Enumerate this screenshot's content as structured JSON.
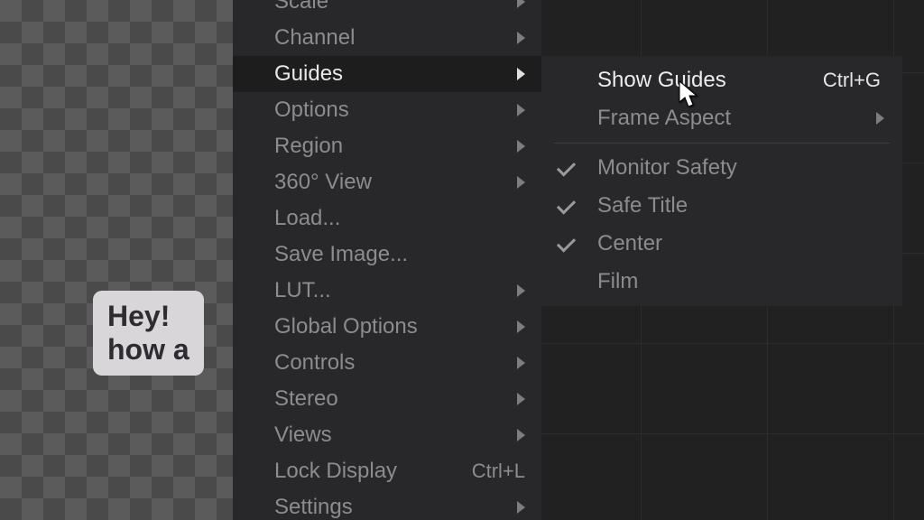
{
  "canvas_text": {
    "line1": "Hey!",
    "line2": "how a"
  },
  "menu": {
    "items": [
      {
        "label": "Scale",
        "submenu": true,
        "hover": false,
        "cut": true
      },
      {
        "label": "Channel",
        "submenu": true,
        "hover": false
      },
      {
        "label": "Guides",
        "submenu": true,
        "hover": true
      },
      {
        "label": "Options",
        "submenu": true,
        "hover": false
      },
      {
        "label": "Region",
        "submenu": true,
        "hover": false
      },
      {
        "label": "360° View",
        "submenu": true,
        "hover": false
      },
      {
        "label": "Load...",
        "submenu": false,
        "hover": false
      },
      {
        "label": "Save Image...",
        "submenu": false,
        "hover": false
      },
      {
        "label": "LUT...",
        "submenu": true,
        "hover": false
      },
      {
        "label": "Global Options",
        "submenu": true,
        "hover": false
      },
      {
        "label": "Controls",
        "submenu": true,
        "hover": false
      },
      {
        "label": "Stereo",
        "submenu": true,
        "hover": false
      },
      {
        "label": "Views",
        "submenu": true,
        "hover": false
      },
      {
        "label": "Lock Display",
        "submenu": false,
        "hover": false,
        "shortcut": "Ctrl+L"
      },
      {
        "label": "Settings",
        "submenu": true,
        "hover": false,
        "cutbottom": true
      }
    ]
  },
  "submenu": {
    "items": [
      {
        "label": "Show Guides",
        "shortcut": "Ctrl+G",
        "hover": true
      },
      {
        "label": "Frame Aspect",
        "submenu": true
      },
      {
        "sep": true
      },
      {
        "label": "Monitor Safety",
        "checked": true
      },
      {
        "label": "Safe Title",
        "checked": true
      },
      {
        "label": "Center",
        "checked": true
      },
      {
        "label": "Film"
      }
    ]
  }
}
